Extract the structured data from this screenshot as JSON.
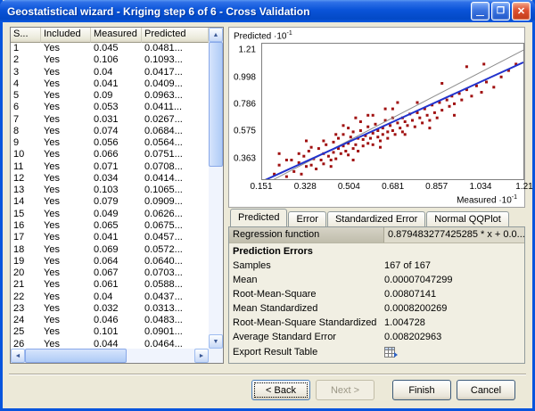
{
  "window": {
    "title": "Geostatistical wizard - Kriging step 6 of 6 - Cross Validation",
    "controls": {
      "minimize": "—",
      "maximize": "❐",
      "close": "✕"
    }
  },
  "icons": {
    "up": "▲",
    "down": "▼",
    "left": "◄",
    "right": "►"
  },
  "table": {
    "columns": [
      "S...",
      "Included",
      "Measured",
      "Predicted"
    ],
    "rows": [
      [
        "1",
        "Yes",
        "0.045",
        "0.0481..."
      ],
      [
        "2",
        "Yes",
        "0.106",
        "0.1093..."
      ],
      [
        "3",
        "Yes",
        "0.04",
        "0.0417..."
      ],
      [
        "4",
        "Yes",
        "0.041",
        "0.0409..."
      ],
      [
        "5",
        "Yes",
        "0.09",
        "0.0963..."
      ],
      [
        "6",
        "Yes",
        "0.053",
        "0.0411..."
      ],
      [
        "7",
        "Yes",
        "0.031",
        "0.0267..."
      ],
      [
        "8",
        "Yes",
        "0.074",
        "0.0684..."
      ],
      [
        "9",
        "Yes",
        "0.056",
        "0.0564..."
      ],
      [
        "10",
        "Yes",
        "0.066",
        "0.0751..."
      ],
      [
        "11",
        "Yes",
        "0.071",
        "0.0708..."
      ],
      [
        "12",
        "Yes",
        "0.034",
        "0.0414..."
      ],
      [
        "13",
        "Yes",
        "0.103",
        "0.1065..."
      ],
      [
        "14",
        "Yes",
        "0.079",
        "0.0909..."
      ],
      [
        "15",
        "Yes",
        "0.049",
        "0.0626..."
      ],
      [
        "16",
        "Yes",
        "0.065",
        "0.0675..."
      ],
      [
        "17",
        "Yes",
        "0.041",
        "0.0457..."
      ],
      [
        "18",
        "Yes",
        "0.069",
        "0.0572..."
      ],
      [
        "19",
        "Yes",
        "0.064",
        "0.0640..."
      ],
      [
        "20",
        "Yes",
        "0.067",
        "0.0703..."
      ],
      [
        "21",
        "Yes",
        "0.061",
        "0.0588..."
      ],
      [
        "22",
        "Yes",
        "0.04",
        "0.0437..."
      ],
      [
        "23",
        "Yes",
        "0.032",
        "0.0313..."
      ],
      [
        "24",
        "Yes",
        "0.046",
        "0.0483..."
      ],
      [
        "25",
        "Yes",
        "0.101",
        "0.0901..."
      ],
      [
        "26",
        "Yes",
        "0.044",
        "0.0464..."
      ]
    ]
  },
  "chart": {
    "type": "scatter",
    "y_axis_label": "Predicted",
    "x_axis_label": "Measured",
    "scale_label": "·10",
    "scale_exponent": "-1",
    "x_ticks": [
      "0.151",
      "0.328",
      "0.504",
      "0.681",
      "0.857",
      "1.034",
      "1.21"
    ],
    "y_ticks": [
      "1.21",
      "0.998",
      "0.786",
      "0.575",
      "0.363"
    ],
    "x_domain": [
      0.151,
      1.21
    ],
    "y_domain": [
      0.2,
      1.26
    ],
    "regression": {
      "slope": 0.879483277425285,
      "intercept": 0.05
    },
    "colors": {
      "point": "#A01010",
      "regression": "#2233CC",
      "reference": "#8C8C8C"
    },
    "points": [
      [
        0.2,
        0.24
      ],
      [
        0.22,
        0.31
      ],
      [
        0.25,
        0.22
      ],
      [
        0.27,
        0.35
      ],
      [
        0.28,
        0.26
      ],
      [
        0.3,
        0.33
      ],
      [
        0.31,
        0.24
      ],
      [
        0.32,
        0.38
      ],
      [
        0.33,
        0.3
      ],
      [
        0.34,
        0.42
      ],
      [
        0.35,
        0.31
      ],
      [
        0.36,
        0.36
      ],
      [
        0.37,
        0.28
      ],
      [
        0.38,
        0.44
      ],
      [
        0.39,
        0.35
      ],
      [
        0.4,
        0.4
      ],
      [
        0.4,
        0.32
      ],
      [
        0.41,
        0.47
      ],
      [
        0.42,
        0.38
      ],
      [
        0.43,
        0.35
      ],
      [
        0.44,
        0.49
      ],
      [
        0.44,
        0.41
      ],
      [
        0.45,
        0.36
      ],
      [
        0.46,
        0.52
      ],
      [
        0.46,
        0.44
      ],
      [
        0.47,
        0.4
      ],
      [
        0.48,
        0.46
      ],
      [
        0.48,
        0.55
      ],
      [
        0.49,
        0.42
      ],
      [
        0.5,
        0.48
      ],
      [
        0.5,
        0.39
      ],
      [
        0.51,
        0.53
      ],
      [
        0.52,
        0.44
      ],
      [
        0.52,
        0.57
      ],
      [
        0.53,
        0.47
      ],
      [
        0.54,
        0.42
      ],
      [
        0.54,
        0.52
      ],
      [
        0.55,
        0.58
      ],
      [
        0.56,
        0.46
      ],
      [
        0.56,
        0.51
      ],
      [
        0.57,
        0.54
      ],
      [
        0.58,
        0.48
      ],
      [
        0.58,
        0.61
      ],
      [
        0.59,
        0.52
      ],
      [
        0.6,
        0.56
      ],
      [
        0.6,
        0.47
      ],
      [
        0.61,
        0.63
      ],
      [
        0.62,
        0.53
      ],
      [
        0.62,
        0.58
      ],
      [
        0.63,
        0.5
      ],
      [
        0.64,
        0.6
      ],
      [
        0.64,
        0.55
      ],
      [
        0.65,
        0.66
      ],
      [
        0.66,
        0.57
      ],
      [
        0.66,
        0.52
      ],
      [
        0.67,
        0.62
      ],
      [
        0.68,
        0.58
      ],
      [
        0.68,
        0.68
      ],
      [
        0.69,
        0.55
      ],
      [
        0.7,
        0.64
      ],
      [
        0.71,
        0.6
      ],
      [
        0.72,
        0.68
      ],
      [
        0.72,
        0.57
      ],
      [
        0.73,
        0.65
      ],
      [
        0.74,
        0.62
      ],
      [
        0.75,
        0.71
      ],
      [
        0.76,
        0.66
      ],
      [
        0.77,
        0.61
      ],
      [
        0.78,
        0.72
      ],
      [
        0.79,
        0.68
      ],
      [
        0.8,
        0.64
      ],
      [
        0.81,
        0.75
      ],
      [
        0.82,
        0.7
      ],
      [
        0.83,
        0.66
      ],
      [
        0.84,
        0.78
      ],
      [
        0.85,
        0.72
      ],
      [
        0.86,
        0.68
      ],
      [
        0.87,
        0.8
      ],
      [
        0.88,
        0.74
      ],
      [
        0.9,
        0.82
      ],
      [
        0.91,
        0.77
      ],
      [
        0.92,
        0.85
      ],
      [
        0.93,
        0.79
      ],
      [
        0.95,
        0.87
      ],
      [
        0.96,
        0.82
      ],
      [
        0.98,
        0.9
      ],
      [
        1.0,
        0.85
      ],
      [
        1.02,
        0.93
      ],
      [
        1.04,
        0.88
      ],
      [
        1.06,
        0.96
      ],
      [
        1.09,
        0.92
      ],
      [
        1.12,
        1.0
      ],
      [
        1.15,
        1.05
      ],
      [
        1.18,
        1.1
      ],
      [
        0.35,
        0.45
      ],
      [
        0.45,
        0.55
      ],
      [
        0.55,
        0.65
      ],
      [
        0.65,
        0.75
      ],
      [
        0.3,
        0.4
      ],
      [
        0.5,
        0.6
      ],
      [
        0.7,
        0.8
      ],
      [
        0.4,
        0.5
      ],
      [
        0.6,
        0.7
      ],
      [
        0.25,
        0.35
      ],
      [
        0.22,
        0.4
      ],
      [
        0.48,
        0.62
      ],
      [
        0.52,
        0.35
      ],
      [
        0.58,
        0.7
      ],
      [
        0.63,
        0.45
      ],
      [
        0.68,
        0.75
      ],
      [
        0.73,
        0.55
      ],
      [
        0.78,
        0.8
      ],
      [
        0.83,
        0.6
      ],
      [
        0.33,
        0.5
      ],
      [
        0.88,
        0.95
      ],
      [
        0.43,
        0.3
      ],
      [
        0.53,
        0.68
      ],
      [
        0.93,
        0.7
      ],
      [
        1.05,
        1.1
      ],
      [
        0.98,
        1.08
      ]
    ]
  },
  "tabs": [
    {
      "label": "Predicted",
      "active": true
    },
    {
      "label": "Error",
      "active": false
    },
    {
      "label": "Standardized Error",
      "active": false
    },
    {
      "label": "Normal QQPlot",
      "active": false
    }
  ],
  "stats": {
    "regression_label": "Regression function",
    "regression_value": "0.879483277425285 * x + 0.0...",
    "section_title": "Prediction Errors",
    "rows": [
      {
        "label": "Samples",
        "value": "167 of 167"
      },
      {
        "label": "Mean",
        "value": "0.00007047299"
      },
      {
        "label": "Root-Mean-Square",
        "value": "0.00807141"
      },
      {
        "label": "Mean Standardized",
        "value": "0.0008200269"
      },
      {
        "label": "Root-Mean-Square Standardized",
        "value": "1.004728"
      },
      {
        "label": "Average Standard Error",
        "value": "0.008202963"
      }
    ],
    "export_label": "Export Result Table"
  },
  "buttons": {
    "back": "< Back",
    "next": "Next >",
    "finish": "Finish",
    "cancel": "Cancel"
  }
}
